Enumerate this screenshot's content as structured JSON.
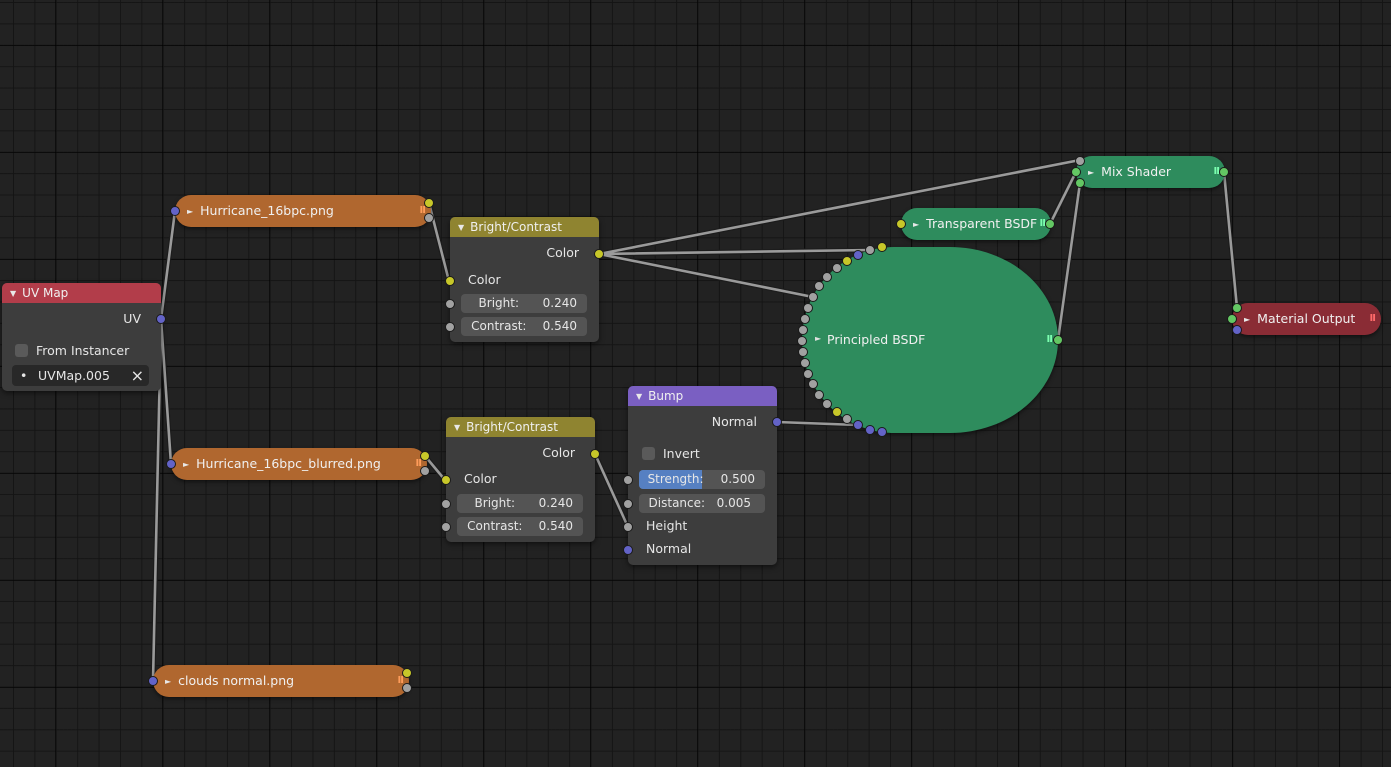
{
  "colors": {
    "background": "#222222",
    "node_body": "#3d3d3d",
    "uv_header": "#b23d4a",
    "brightcontrast_header": "#8f8430",
    "bump_header": "#7a5fc2",
    "image_node": "#b0672f",
    "shader_node": "#2e8c5d",
    "output_node": "#8a2c35",
    "socket_gray": "#a1a1a1",
    "socket_yellow": "#c7c729",
    "socket_blue": "#6363c7",
    "socket_green": "#63c763",
    "slider_fill": "#5680c2",
    "wire": "#9a9a9a"
  },
  "nodes": {
    "uv_map": {
      "title": "UV Map",
      "output_uv": "UV",
      "from_instancer_label": "From Instancer",
      "from_instancer_checked": false,
      "uv_map_value": "UVMap.005",
      "clear_icon": "×",
      "dot_icon": "•"
    },
    "image1": {
      "label": "Hurricane_16bpc.png",
      "collapsed": true
    },
    "image2": {
      "label": "Hurricane_16bpc_blurred.png",
      "collapsed": true
    },
    "image3": {
      "label": "clouds normal.png",
      "collapsed": true
    },
    "bright_contrast_1": {
      "title": "Bright/Contrast",
      "output_color": "Color",
      "input_color": "Color",
      "bright_label": "Bright:",
      "bright_value": "0.240",
      "contrast_label": "Contrast:",
      "contrast_value": "0.540"
    },
    "bright_contrast_2": {
      "title": "Bright/Contrast",
      "output_color": "Color",
      "input_color": "Color",
      "bright_label": "Bright:",
      "bright_value": "0.240",
      "contrast_label": "Contrast:",
      "contrast_value": "0.540"
    },
    "bump": {
      "title": "Bump",
      "output_normal": "Normal",
      "invert_label": "Invert",
      "invert_checked": false,
      "strength_label": "Strength:",
      "strength_value": "0.500",
      "strength_fraction": 0.5,
      "distance_label": "Distance:",
      "distance_value": "0.005",
      "height_label": "Height",
      "normal_label": "Normal"
    },
    "principled": {
      "label": "Principled BSDF",
      "collapsed": true
    },
    "transparent": {
      "label": "Transparent BSDF",
      "collapsed": true
    },
    "mix_shader": {
      "label": "Mix Shader",
      "collapsed": true
    },
    "material_output": {
      "label": "Material Output",
      "collapsed": true
    }
  },
  "icons": {
    "collapse_triangle": "▼",
    "expand_triangle": "►",
    "hidden_sockets": "II"
  }
}
